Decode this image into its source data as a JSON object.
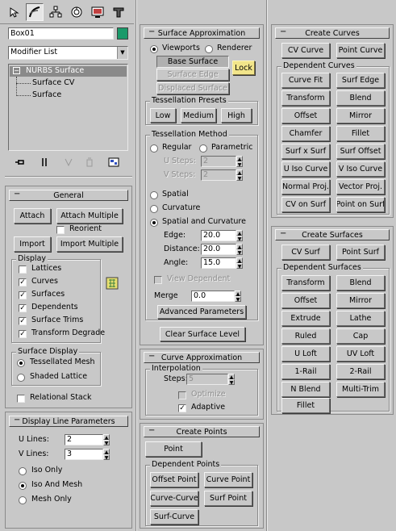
{
  "toolbar": {
    "tabs": [
      "create-icon",
      "modify-icon",
      "hierarchy-icon",
      "motion-icon",
      "display-icon",
      "utilities-icon"
    ]
  },
  "object_name": "Box01",
  "object_color": "#1a9a6a",
  "modifier_list": "Modifier List",
  "stack": {
    "root": "NURBS Surface",
    "children": [
      "Surface CV",
      "Surface"
    ]
  },
  "stack_buttons": [
    "pin-stack-icon",
    "show-end-result-icon",
    "make-unique-icon",
    "remove-modifier-icon",
    "configure-sets-icon"
  ],
  "general": {
    "title": "General",
    "attach": "Attach",
    "attach_multiple": "Attach Multiple",
    "reorient": "Reorient",
    "import": "Import",
    "import_multiple": "Import Multiple",
    "display_title": "Display",
    "display_items": [
      {
        "label": "Lattices",
        "checked": false
      },
      {
        "label": "Curves",
        "checked": true
      },
      {
        "label": "Surfaces",
        "checked": true
      },
      {
        "label": "Dependents",
        "checked": true
      },
      {
        "label": "Surface Trims",
        "checked": true
      },
      {
        "label": "Transform Degrade",
        "checked": true
      }
    ],
    "surface_display_title": "Surface Display",
    "tessellated_mesh": "Tessellated Mesh",
    "shaded_lattice": "Shaded Lattice",
    "relational_stack": "Relational Stack"
  },
  "display_line": {
    "title": "Display Line Parameters",
    "u_lines_label": "U Lines:",
    "u_lines": "2",
    "v_lines_label": "V Lines:",
    "v_lines": "3",
    "iso_only": "Iso Only",
    "iso_and_mesh": "Iso And Mesh",
    "mesh_only": "Mesh Only"
  },
  "surface_approx": {
    "title": "Surface Approximation",
    "viewports": "Viewports",
    "renderer": "Renderer",
    "base_surface": "Base Surface",
    "lock": "Lock",
    "surface_edge": "Surface Edge",
    "displaced_surface": "Displaced Surface",
    "presets_title": "Tessellation Presets",
    "low": "Low",
    "medium": "Medium",
    "high": "High",
    "method_title": "Tessellation Method",
    "regular": "Regular",
    "parametric": "Parametric",
    "u_steps_label": "U Steps:",
    "u_steps": "2",
    "v_steps_label": "V Steps:",
    "v_steps": "2",
    "spatial": "Spatial",
    "curvature": "Curvature",
    "spatial_curvature": "Spatial and Curvature",
    "edge_label": "Edge:",
    "edge": "20.0",
    "distance_label": "Distance:",
    "distance": "20.0",
    "angle_label": "Angle:",
    "angle": "15.0",
    "view_dependent": "View Dependent",
    "merge_label": "Merge",
    "merge": "0.0",
    "advanced": "Advanced Parameters",
    "clear": "Clear Surface Level"
  },
  "curve_approx": {
    "title": "Curve Approximation",
    "interpolation": "Interpolation",
    "steps_label": "Steps:",
    "steps": "5",
    "optimize": "Optimize",
    "adaptive": "Adaptive"
  },
  "create_points": {
    "title": "Create Points",
    "point": "Point",
    "dependent_title": "Dependent Points",
    "buttons": [
      "Offset Point",
      "Curve Point",
      "Curve-Curve",
      "Surf Point",
      "Surf-Curve"
    ]
  },
  "create_curves": {
    "title": "Create Curves",
    "cv_curve": "CV Curve",
    "point_curve": "Point Curve",
    "dependent_title": "Dependent Curves",
    "buttons": [
      "Curve Fit",
      "Surf Edge",
      "Transform",
      "Blend",
      "Offset",
      "Mirror",
      "Chamfer",
      "Fillet",
      "Surf x Surf",
      "Surf Offset",
      "U Iso Curve",
      "V Iso Curve",
      "Normal Proj.",
      "Vector Proj.",
      "CV on Surf",
      "Point on Surf"
    ]
  },
  "create_surfaces": {
    "title": "Create Surfaces",
    "cv_surf": "CV Surf",
    "point_surf": "Point Surf",
    "dependent_title": "Dependent Surfaces",
    "buttons": [
      "Transform",
      "Blend",
      "Offset",
      "Mirror",
      "Extrude",
      "Lathe",
      "Ruled",
      "Cap",
      "U Loft",
      "UV Loft",
      "1-Rail",
      "2-Rail",
      "N Blend",
      "Multi-Trim",
      "Fillet"
    ]
  }
}
